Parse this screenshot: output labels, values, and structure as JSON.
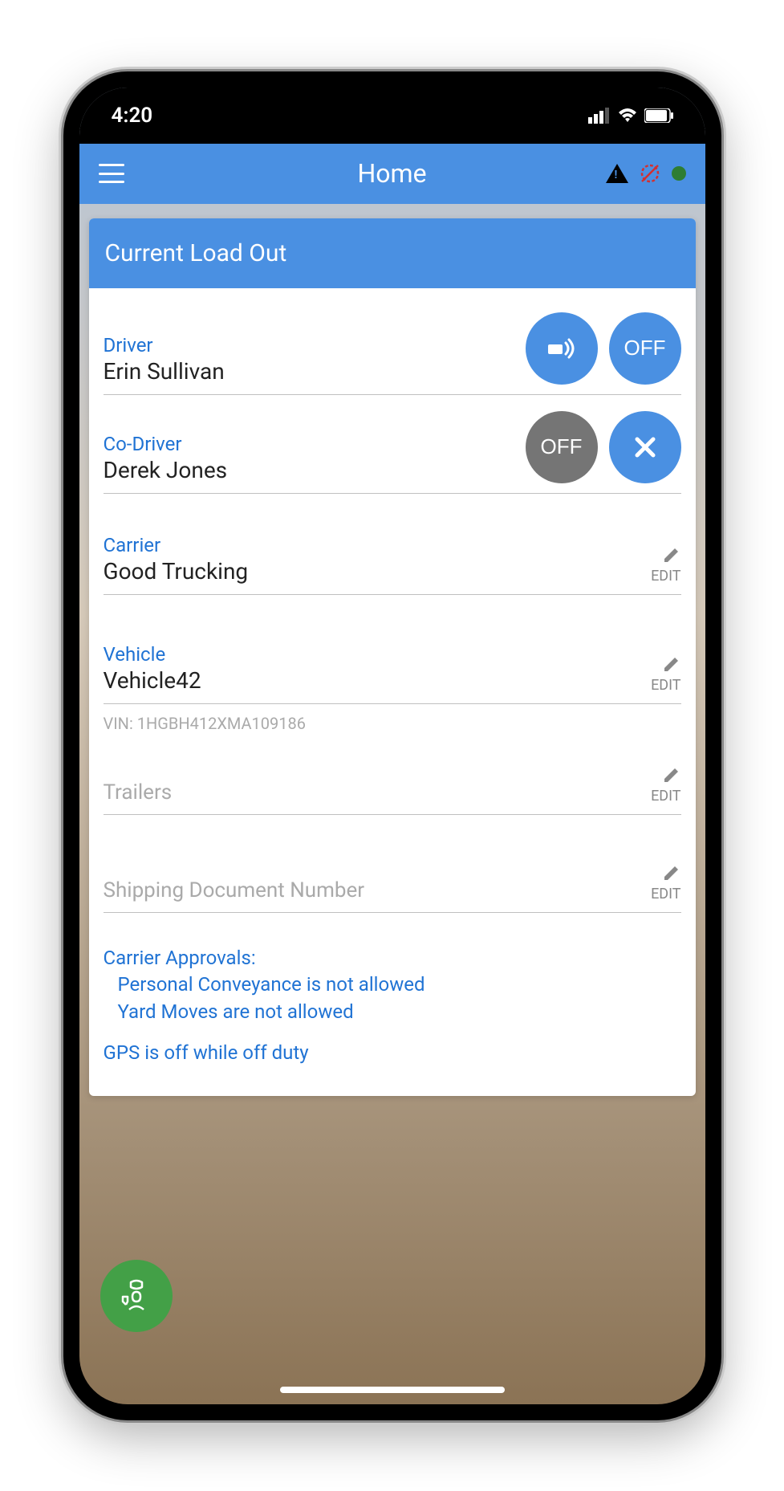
{
  "status": {
    "time": "4:20"
  },
  "header": {
    "title": "Home"
  },
  "card": {
    "title": "Current Load Out",
    "driver": {
      "label": "Driver",
      "value": "Erin Sullivan",
      "status": "OFF"
    },
    "codriver": {
      "label": "Co-Driver",
      "value": "Derek Jones",
      "status": "OFF"
    },
    "carrier": {
      "label": "Carrier",
      "value": "Good Trucking",
      "edit": "EDIT"
    },
    "vehicle": {
      "label": "Vehicle",
      "value": "Vehicle42",
      "edit": "EDIT",
      "vin": "VIN: 1HGBH412XMA109186"
    },
    "trailers": {
      "placeholder": "Trailers",
      "edit": "EDIT"
    },
    "shipping": {
      "placeholder": "Shipping Document Number",
      "edit": "EDIT"
    },
    "approvals": {
      "heading": "Carrier Approvals:",
      "line1": "Personal Conveyance is not allowed",
      "line2": "Yard Moves are not allowed"
    },
    "gps_note": "GPS is off while off duty"
  }
}
